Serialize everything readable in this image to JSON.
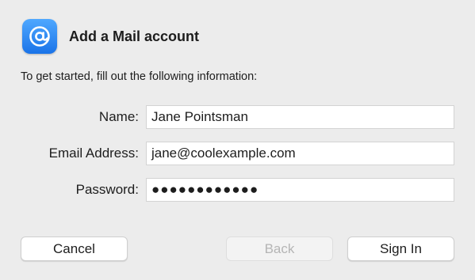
{
  "dialog": {
    "title": "Add a Mail account",
    "intro": "To get started, fill out the following information:",
    "icon": "at-sign-mail-icon"
  },
  "form": {
    "name_label": "Name:",
    "name_value": "Jane Pointsman",
    "email_label": "Email Address:",
    "email_value": "jane@coolexample.com",
    "password_label": "Password:",
    "password_value": "●●●●●●●●●●●●"
  },
  "buttons": {
    "cancel": "Cancel",
    "back": "Back",
    "sign_in": "Sign In"
  },
  "colors": {
    "background": "#ececec",
    "icon_blue": "#1a73e8",
    "disabled_text": "#b5b5b5"
  }
}
